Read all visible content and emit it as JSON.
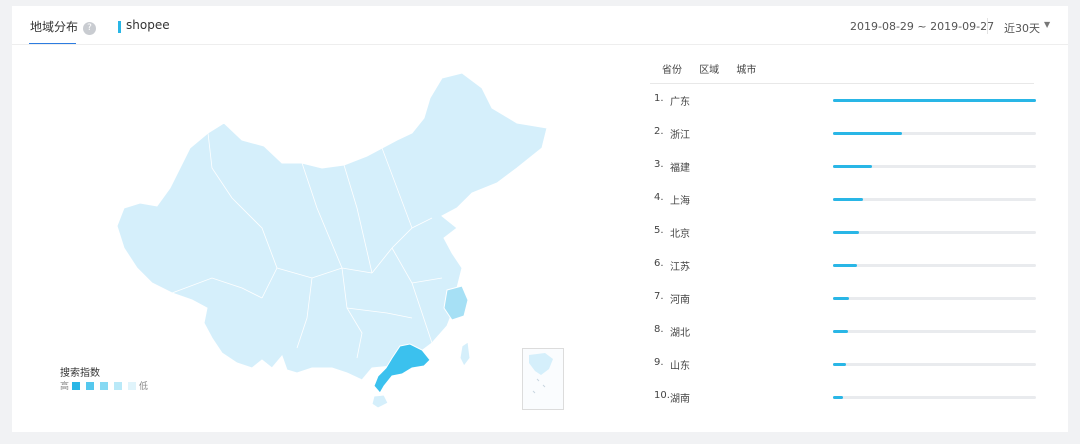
{
  "header": {
    "tab_active": "地域分布",
    "help_icon": "?",
    "keyword": "shopee",
    "date_range": "2019-08-29 ~ 2019-09-27",
    "period": "近30天",
    "caret": "▼"
  },
  "map": {
    "legend_title": "搜索指数",
    "legend_high": "高",
    "legend_low": "低",
    "legend_colors": [
      "#29b6e6",
      "#55c8ee",
      "#86d9f3",
      "#b9e9f8",
      "#e0f4fb"
    ],
    "base_color": "#d5effb",
    "highlight_color": "#3bc1ee",
    "mid_color": "#a6e0f5",
    "inset_text": "南海诸岛"
  },
  "ranking": {
    "tabs": [
      "省份",
      "区域",
      "城市"
    ],
    "bar_color": "#29b6e6",
    "items": [
      {
        "rank": "1.",
        "name": "广东",
        "value": 1.0
      },
      {
        "rank": "2.",
        "name": "浙江",
        "value": 0.34
      },
      {
        "rank": "3.",
        "name": "福建",
        "value": 0.19
      },
      {
        "rank": "4.",
        "name": "上海",
        "value": 0.15
      },
      {
        "rank": "5.",
        "name": "北京",
        "value": 0.13
      },
      {
        "rank": "6.",
        "name": "江苏",
        "value": 0.12
      },
      {
        "rank": "7.",
        "name": "河南",
        "value": 0.08
      },
      {
        "rank": "8.",
        "name": "湖北",
        "value": 0.075
      },
      {
        "rank": "9.",
        "name": "山东",
        "value": 0.065
      },
      {
        "rank": "10.",
        "name": "湖南",
        "value": 0.05
      }
    ]
  }
}
